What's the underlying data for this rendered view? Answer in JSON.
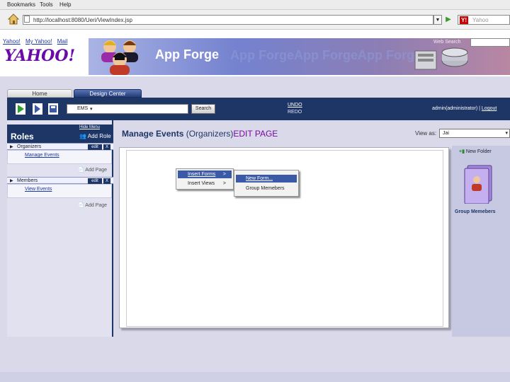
{
  "browser": {
    "menu": [
      "Bookmarks",
      "Tools",
      "Help"
    ],
    "url": "http://localhost:8080/Ueri/ViewIndex.jsp",
    "search_placeholder": "Yahoo"
  },
  "yahoo": {
    "links": [
      "Yahoo!",
      "My Yahoo!",
      "Mail"
    ],
    "logo": "YAHOO!",
    "search_label": "Web Search"
  },
  "banner": {
    "title": "App Forge",
    "watermark": "App Forge"
  },
  "tabs": [
    {
      "label": "Home"
    },
    {
      "label": "Design Center"
    }
  ],
  "toolbar": {
    "ems_value": "EMS",
    "search_label": "Search",
    "undo_label": "UNDO",
    "redo_label": "REDO",
    "admin_label": "admin(administrator)",
    "logout_label": "Logout"
  },
  "sidebar": {
    "hide_menu": "Hide Menu",
    "title": "Roles",
    "add_role": "Add Role",
    "roles": [
      {
        "name": "Organizers",
        "edit": "edit",
        "delete": "X",
        "page": "Manage Events",
        "add_page": "Add Page"
      },
      {
        "name": "Members",
        "edit": "edit",
        "delete": "X",
        "page": "View Events",
        "add_page": "Add Page"
      }
    ]
  },
  "main": {
    "title_a": "Manage Events ",
    "title_b": "(Organizers)",
    "title_c": "EDIT PAGE",
    "view_as_label": "View as:",
    "view_as_value": "Jai",
    "new_folder": "New Folder",
    "folder_label": "Group Memebers"
  },
  "context_menu": {
    "level1": [
      {
        "label": "Insert Forms",
        "arrow": ">"
      },
      {
        "label": "Insert Views",
        "arrow": ">"
      }
    ],
    "level2": [
      {
        "label": "New Form..."
      },
      {
        "label": "Group Memebers"
      }
    ]
  },
  "colors": {
    "navy": "#1e3666",
    "purple_accent": "#7a0aa0",
    "yahoo_purple": "#6b0aa8",
    "selection": "#3a5aa8"
  }
}
